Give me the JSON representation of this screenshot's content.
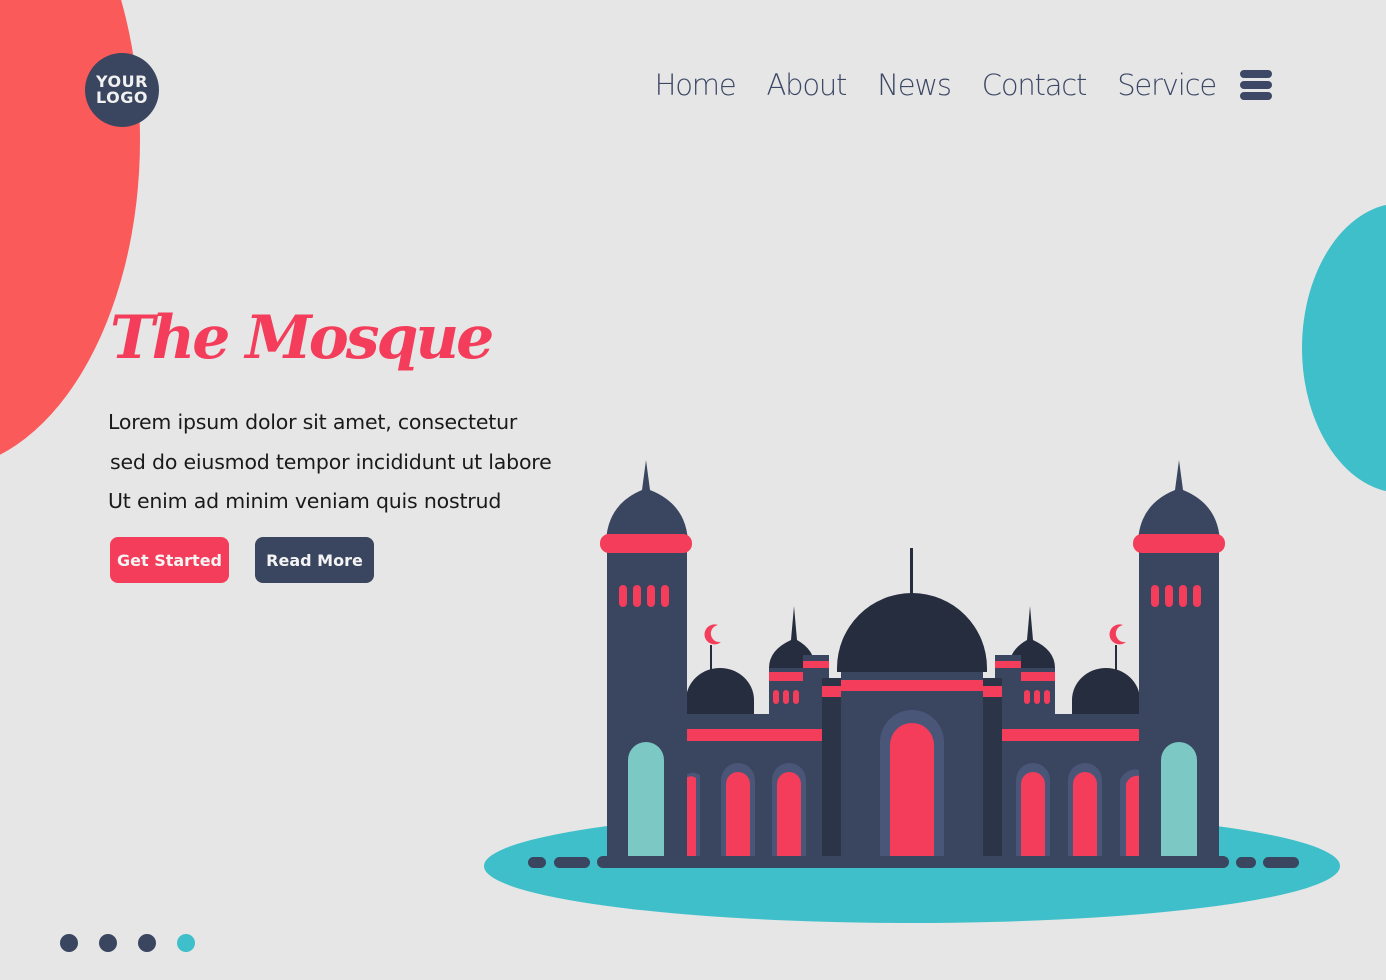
{
  "logo": {
    "line1": "YOUR",
    "line2": "LOGO"
  },
  "nav": {
    "items": [
      {
        "label": "Home"
      },
      {
        "label": "About"
      },
      {
        "label": "News"
      },
      {
        "label": "Contact"
      },
      {
        "label": "Service"
      }
    ],
    "menu_icon": "hamburger-menu-icon"
  },
  "hero": {
    "title": "The Mosque",
    "lines": [
      "Lorem ipsum dolor sit amet, consectetur",
      "sed do eiusmod tempor incididunt ut labore",
      "Ut enim ad minim veniam quis nostrud"
    ],
    "primary_button": "Get Started",
    "secondary_button": "Read More"
  },
  "carousel": {
    "slide_count": 4,
    "active_index": 3
  },
  "colors": {
    "background": "#e6e6e6",
    "accent_red": "#f43d5a",
    "blob_red": "#fb5a5a",
    "teal": "#3fbfc9",
    "navy": "#3a4560",
    "dark_dome": "#262d3e",
    "mint": "#7cc8c4"
  },
  "illustration": "mosque-illustration"
}
